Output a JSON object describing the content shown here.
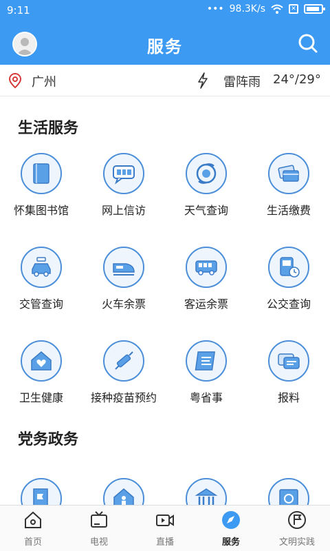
{
  "status": {
    "time": "9:11",
    "speed": "98.3K/s"
  },
  "header": {
    "title": "服务"
  },
  "weather": {
    "city": "广州",
    "condition": "雷阵雨",
    "temperature": "24°/29°"
  },
  "sections": [
    {
      "title": "生活服务",
      "items": [
        {
          "label": "怀集图书馆",
          "icon": "library-book-icon"
        },
        {
          "label": "网上信访",
          "icon": "petition-chat-icon"
        },
        {
          "label": "天气查询",
          "icon": "weather-typhoon-icon"
        },
        {
          "label": "生活缴费",
          "icon": "payment-card-icon"
        },
        {
          "label": "交管查询",
          "icon": "car-icon"
        },
        {
          "label": "火车余票",
          "icon": "train-icon"
        },
        {
          "label": "客运余票",
          "icon": "bus-icon"
        },
        {
          "label": "公交查询",
          "icon": "bus-clock-icon"
        },
        {
          "label": "卫生健康",
          "icon": "health-house-icon"
        },
        {
          "label": "接种疫苗预约",
          "icon": "vaccine-syringe-icon"
        },
        {
          "label": "粤省事",
          "icon": "yue-app-icon"
        },
        {
          "label": "报料",
          "icon": "report-message-icon"
        }
      ]
    },
    {
      "title": "党务政务",
      "items": [
        {
          "label": "",
          "icon": "party-document-icon"
        },
        {
          "label": "",
          "icon": "person-house-icon"
        },
        {
          "label": "",
          "icon": "government-building-icon"
        },
        {
          "label": "",
          "icon": "party-emblem-icon"
        }
      ]
    }
  ],
  "tabs": [
    {
      "label": "首页",
      "icon": "home-icon",
      "active": false
    },
    {
      "label": "电视",
      "icon": "tv-icon",
      "active": false
    },
    {
      "label": "直播",
      "icon": "live-video-icon",
      "active": false
    },
    {
      "label": "服务",
      "icon": "compass-icon",
      "active": true
    },
    {
      "label": "文明实践",
      "icon": "flag-circle-icon",
      "active": false
    }
  ],
  "colors": {
    "primary": "#3d9af2",
    "icon_stroke": "#4a8fd8",
    "icon_fill": "#eef5fd"
  }
}
